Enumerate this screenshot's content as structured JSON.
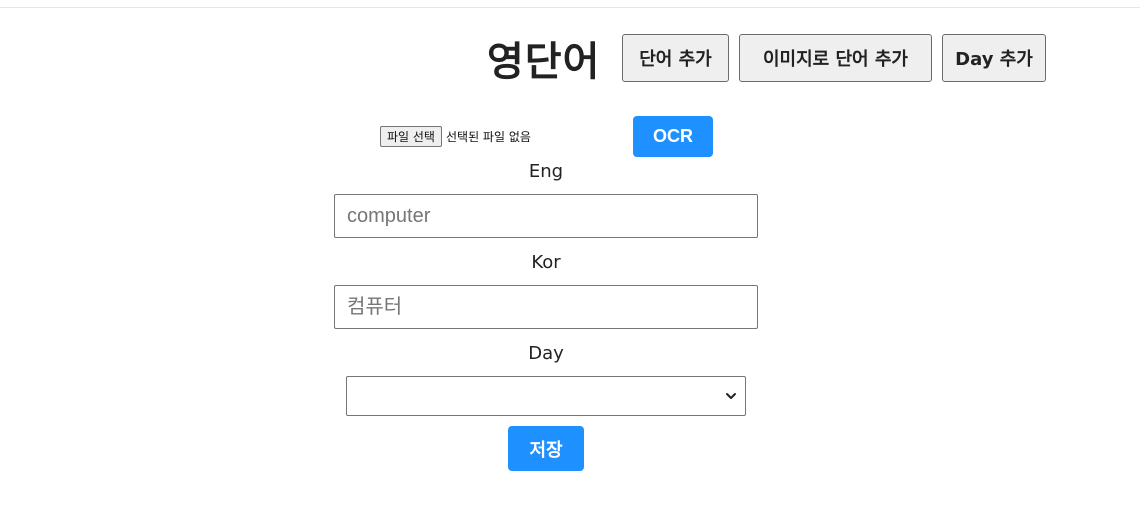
{
  "header": {
    "title": "영단어",
    "buttons": {
      "add_word": "단어 추가",
      "add_word_from_image": "이미지로 단어 추가",
      "add_day": "Day 추가"
    }
  },
  "ocr": {
    "file_button_label": "파일 선택",
    "file_status": "선택된 파일 없음",
    "ocr_button_label": "OCR"
  },
  "form": {
    "eng": {
      "label": "Eng",
      "value": "",
      "placeholder": "computer"
    },
    "kor": {
      "label": "Kor",
      "value": "",
      "placeholder": "컴퓨터"
    },
    "day": {
      "label": "Day",
      "selected": ""
    },
    "save_label": "저장"
  },
  "colors": {
    "primary_button": "#1e90ff",
    "secondary_button": "#efefef"
  },
  "icons": {
    "day_select_arrow": "chevron-down-icon"
  }
}
